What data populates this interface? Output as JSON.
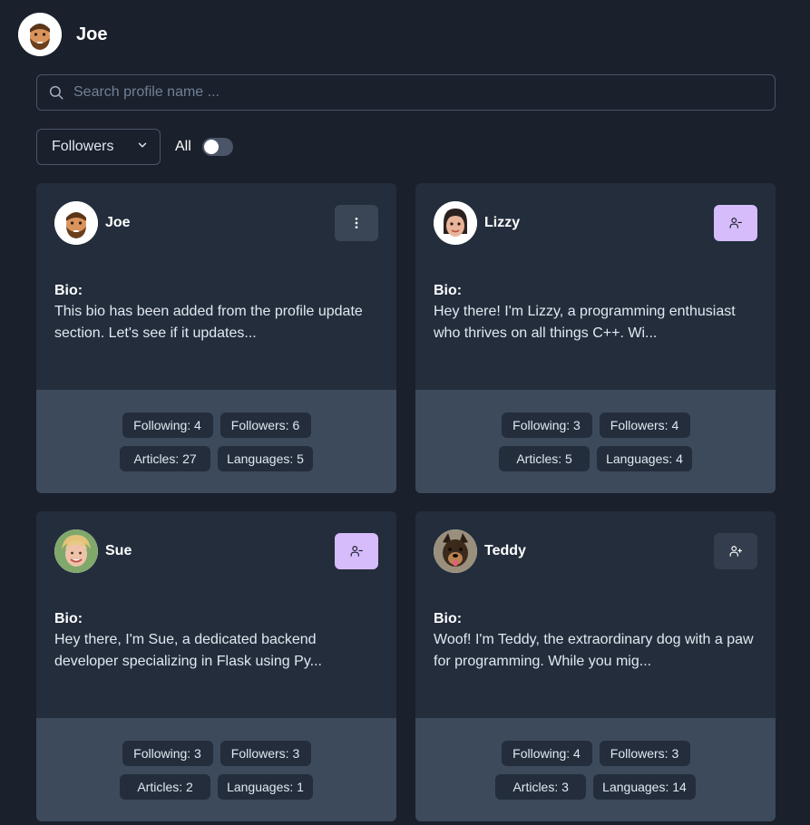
{
  "header": {
    "name": "Joe"
  },
  "search": {
    "placeholder": "Search profile name ..."
  },
  "filter": {
    "selected": "Followers",
    "toggle_label": "All",
    "toggle_on": false
  },
  "accent": "#d6bcfa",
  "cards": [
    {
      "name": "Joe",
      "action": "menu",
      "bio_label": "Bio:",
      "bio": "This bio has been added from the profile update section. Let's see if it updates...",
      "following": "Following: 4",
      "followers": "Followers: 6",
      "articles": "Articles: 27",
      "languages": "Languages: 5"
    },
    {
      "name": "Lizzy",
      "action": "unfollow",
      "bio_label": "Bio:",
      "bio": "Hey there! I'm Lizzy, a programming enthusiast who thrives on all things C++. Wi...",
      "following": "Following: 3",
      "followers": "Followers: 4",
      "articles": "Articles: 5",
      "languages": "Languages: 4"
    },
    {
      "name": "Sue",
      "action": "unfollow",
      "bio_label": "Bio:",
      "bio": "Hey there, I'm Sue, a dedicated backend developer specializing in Flask using Py...",
      "following": "Following: 3",
      "followers": "Followers: 3",
      "articles": "Articles: 2",
      "languages": "Languages: 1"
    },
    {
      "name": "Teddy",
      "action": "follow",
      "bio_label": "Bio:",
      "bio": "Woof! I'm Teddy, the extraordinary dog with a paw for programming. While you mig...",
      "following": "Following: 4",
      "followers": "Followers: 3",
      "articles": "Articles: 3",
      "languages": "Languages: 14"
    }
  ]
}
